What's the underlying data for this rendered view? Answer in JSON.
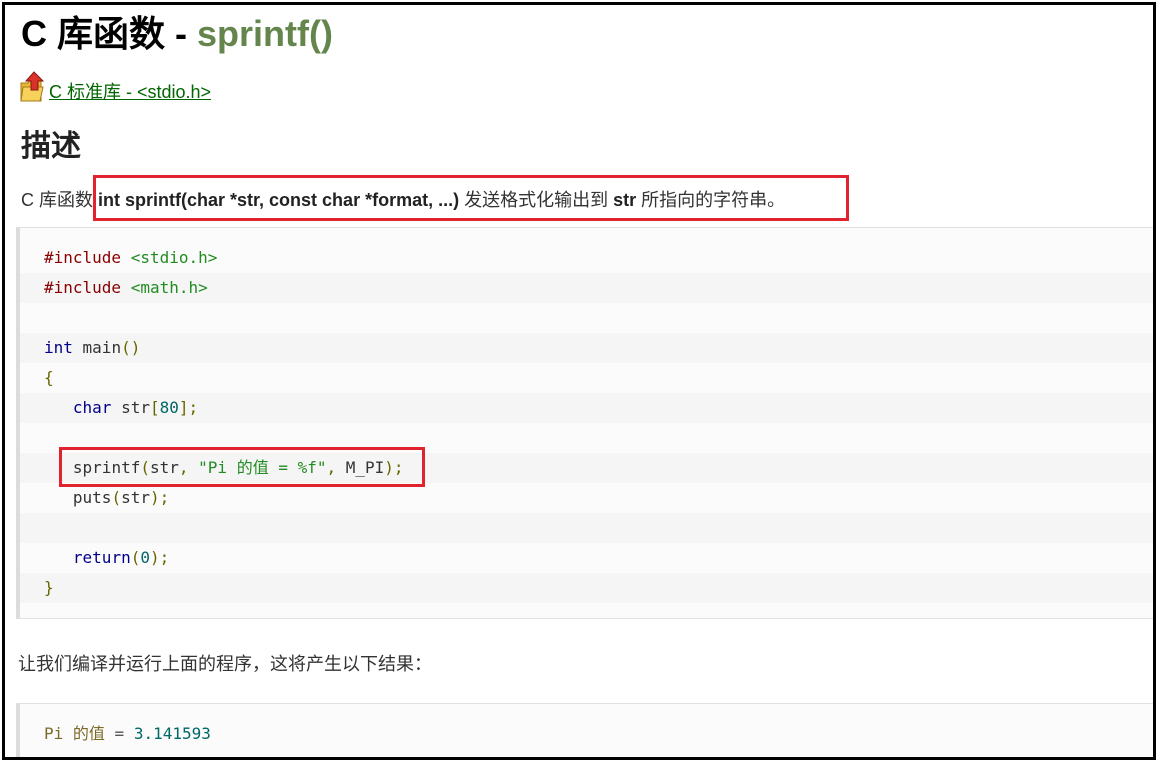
{
  "title": {
    "prefix": "C 库函数 - ",
    "function": "sprintf()"
  },
  "back_link": {
    "icon": "up-arrow-folder-icon",
    "label": " C 标准库 - <stdio.h>"
  },
  "section": {
    "heading": "描述"
  },
  "description": {
    "lead": "C 库函数 ",
    "signature": "int sprintf(char *str, const char *format, ...)",
    "middle": " 发送格式化输出到 ",
    "param": "str",
    "tail": " 所指向的字符串。"
  },
  "code": {
    "line1": {
      "directive": "#include",
      "space": " ",
      "header": "<stdio.h>"
    },
    "line2": {
      "directive": "#include",
      "space": " ",
      "header": "<math.h>"
    },
    "line4": {
      "type": "int",
      "name": " main",
      "parens": "()"
    },
    "line5": {
      "brace": "{"
    },
    "line6": {
      "indent": "   ",
      "type": "char",
      "name": " str",
      "open": "[",
      "size": "80",
      "close": "];"
    },
    "line8": {
      "indent": "   ",
      "fn": "sprintf",
      "open": "(",
      "arg1": "str",
      "comma": ", ",
      "fmt": "\"Pi 的值 = %f\"",
      "comma2": ", ",
      "arg3": "M_PI",
      "close": ");"
    },
    "line9": {
      "indent": "   ",
      "fn": "puts",
      "open": "(",
      "arg": "str",
      "close": ");"
    },
    "line11": {
      "indent": "   ",
      "kw": "return",
      "open": "(",
      "val": "0",
      "close": ");"
    },
    "line12": {
      "brace": "}"
    }
  },
  "run_text": "让我们编译并运行上面的程序，这将产生以下结果：",
  "output": {
    "label": "Pi 的值",
    "op": " = ",
    "value": "3.141593"
  },
  "colors": {
    "function_title": "#64854c",
    "link": "#006600",
    "highlight": "#e0232f"
  }
}
